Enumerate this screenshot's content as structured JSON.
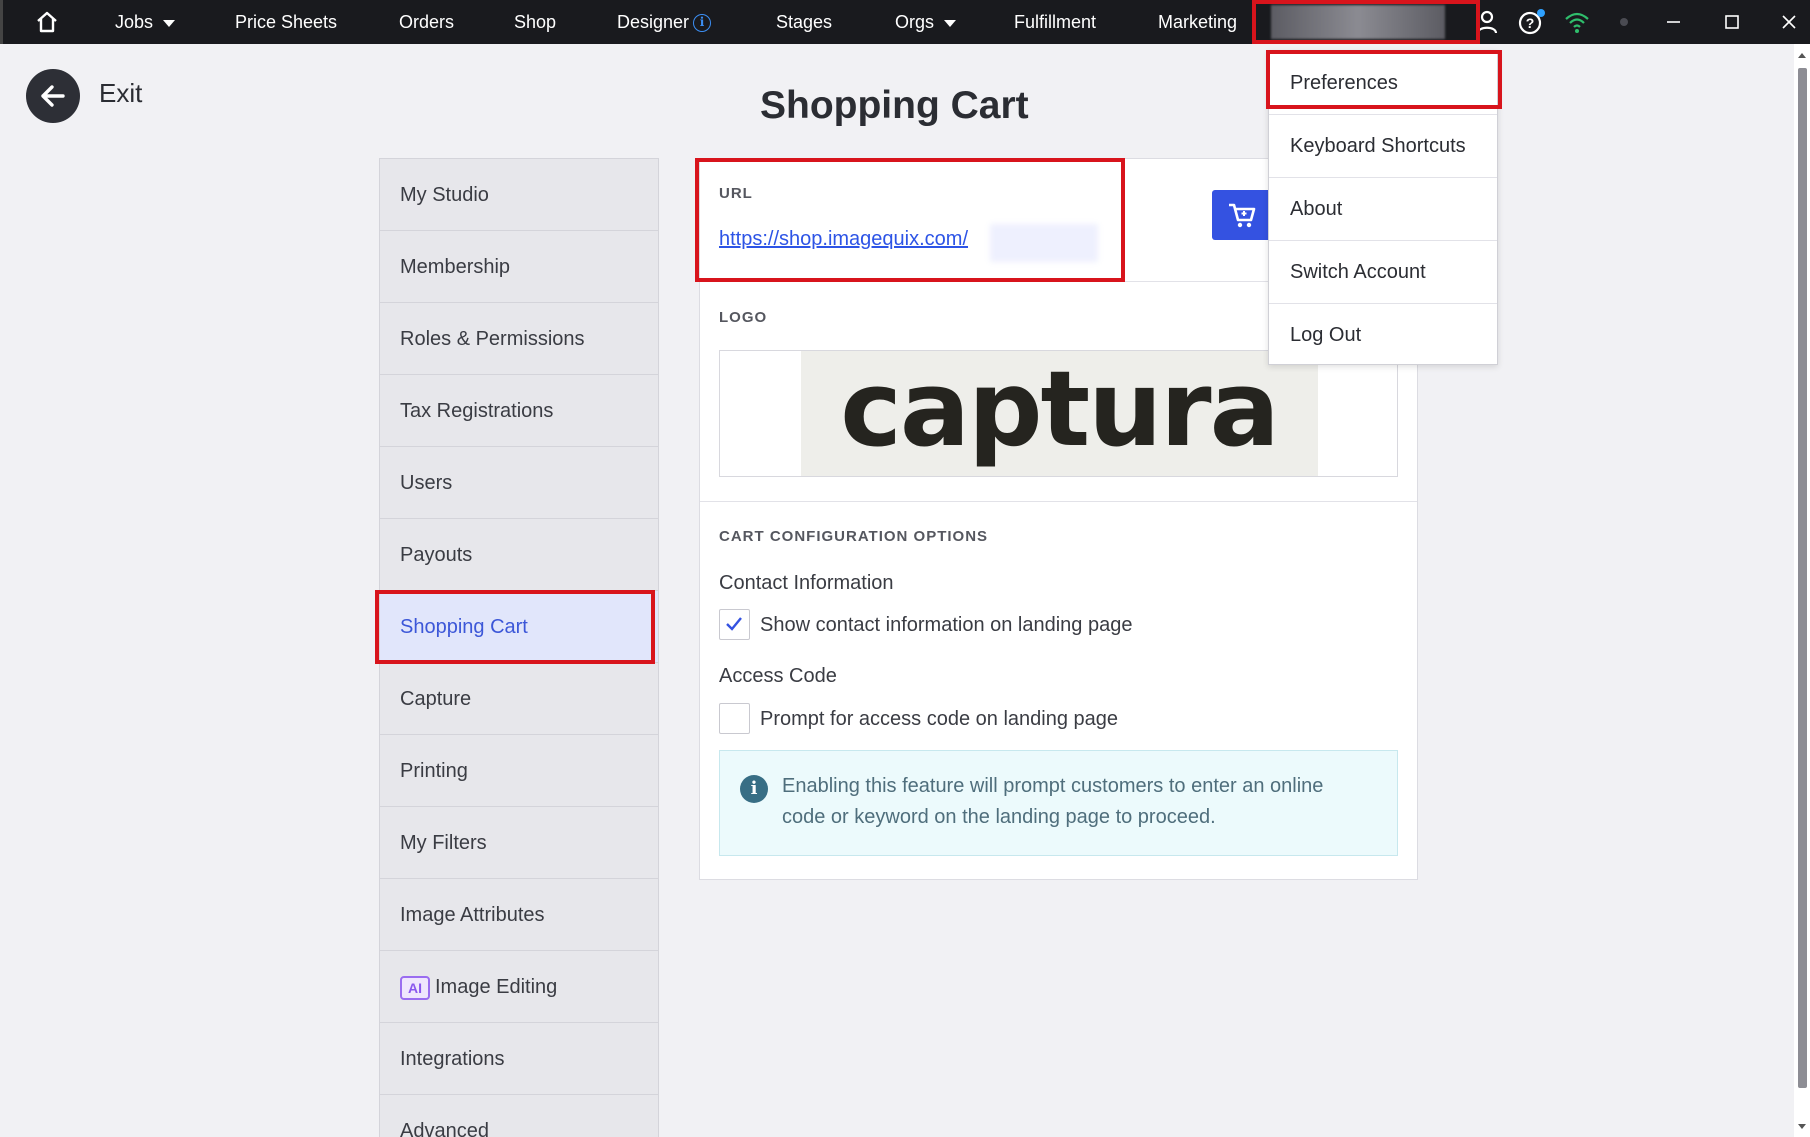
{
  "topbar": {
    "nav": {
      "jobs": "Jobs",
      "price_sheets": "Price Sheets",
      "orders": "Orders",
      "shop": "Shop",
      "designer": "Designer",
      "stages": "Stages",
      "orgs": "Orgs",
      "fulfillment": "Fulfillment",
      "marketing": "Marketing"
    },
    "icons": [
      "home-icon",
      "info-icon",
      "caret-down-icon",
      "user-icon",
      "help-icon",
      "wifi-icon",
      "status-dot-icon",
      "minimize-icon",
      "maximize-icon",
      "close-icon"
    ]
  },
  "exit": {
    "label": "Exit"
  },
  "page": {
    "title": "Shopping Cart"
  },
  "sidebar": {
    "items": [
      {
        "label": "My Studio"
      },
      {
        "label": "Membership"
      },
      {
        "label": "Roles & Permissions"
      },
      {
        "label": "Tax Registrations"
      },
      {
        "label": "Users"
      },
      {
        "label": "Payouts"
      },
      {
        "label": "Shopping Cart",
        "active": true
      },
      {
        "label": "Capture"
      },
      {
        "label": "Printing"
      },
      {
        "label": "My Filters"
      },
      {
        "label": "Image Attributes"
      },
      {
        "label": "Image Editing",
        "badge": "AI"
      },
      {
        "label": "Integrations"
      },
      {
        "label": "Advanced"
      }
    ]
  },
  "url_section": {
    "label": "URL",
    "link": "https://shop.imagequix.com/"
  },
  "logo_section": {
    "label": "LOGO",
    "logo_text": "captura"
  },
  "cart_config": {
    "label": "CART CONFIGURATION OPTIONS",
    "contact_heading": "Contact Information",
    "contact_checkbox": "Show contact information on landing page",
    "contact_checked": true,
    "access_heading": "Access Code",
    "access_checkbox": "Prompt for access code on landing page",
    "access_checked": false,
    "notice": "Enabling this feature will prompt customers to enter an online code or keyword on the landing page to proceed."
  },
  "user_menu": {
    "items": [
      {
        "label": "Preferences"
      },
      {
        "label": "Keyboard Shortcuts"
      },
      {
        "label": "About"
      },
      {
        "label": "Switch Account"
      },
      {
        "label": "Log Out"
      }
    ]
  },
  "colors": {
    "accent": "#3452e1",
    "highlight_box": "#d8141c",
    "topbar": "#191a1e",
    "notice_bg": "#ecfafc"
  }
}
